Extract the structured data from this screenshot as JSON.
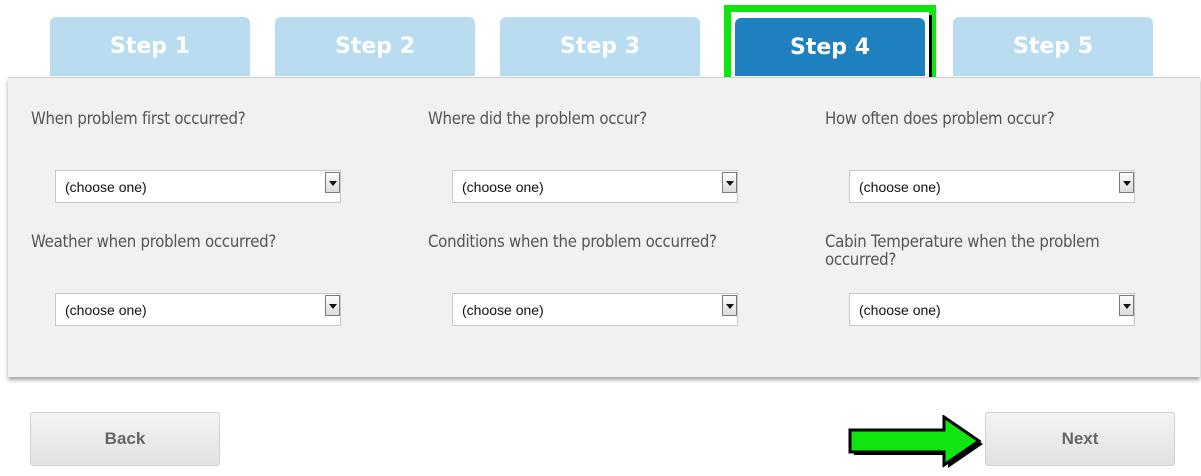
{
  "tabs": [
    {
      "label": "Step 1",
      "active": false
    },
    {
      "label": "Step 2",
      "active": false
    },
    {
      "label": "Step 3",
      "active": false
    },
    {
      "label": "Step 4",
      "active": true
    },
    {
      "label": "Step 5",
      "active": false
    }
  ],
  "fields": [
    {
      "label": "When problem first occurred?",
      "value": "(choose one)"
    },
    {
      "label": "Where did the problem occur?",
      "value": "(choose one)"
    },
    {
      "label": "How often does problem occur?",
      "value": "(choose one)"
    },
    {
      "label": "Weather when problem occurred?",
      "value": "(choose one)"
    },
    {
      "label": "Conditions when the problem occurred?",
      "value": "(choose one)"
    },
    {
      "label": "Cabin Temperature when the problem occurred?",
      "value": "(choose one)"
    }
  ],
  "buttons": {
    "back": "Back",
    "next": "Next"
  },
  "colors": {
    "tab_inactive": "#b9dcf1",
    "tab_active": "#1f80c0",
    "highlight": "#0fe60f",
    "panel": "#f1f1f1"
  }
}
